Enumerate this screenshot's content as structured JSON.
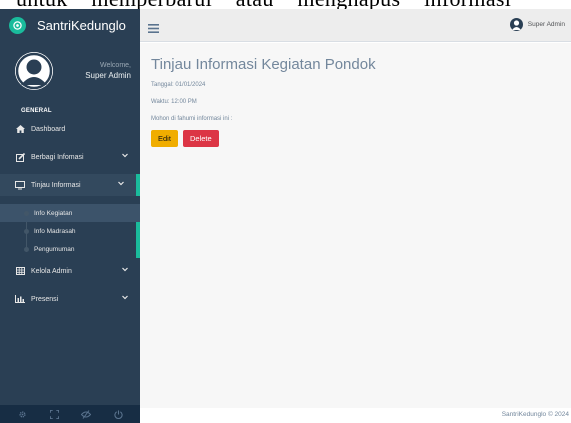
{
  "top_text": "untuk memperbarui atau menghapus informasi",
  "brand": {
    "name": "SantriKedunglo",
    "logo": "logo-icon"
  },
  "profile": {
    "welcome": "Welcome,",
    "name": "Super Admin"
  },
  "sidebar": {
    "section": "GENERAL",
    "items": [
      {
        "label": "Dashboard",
        "icon": "home-icon"
      },
      {
        "label": "Berbagi Infomasi",
        "icon": "edit-icon"
      },
      {
        "label": "Tinjau Informasi",
        "icon": "monitor-icon"
      }
    ],
    "submenu": [
      {
        "label": "Info Kegiatan"
      },
      {
        "label": "Info Madrasah"
      },
      {
        "label": "Pengumuman"
      }
    ],
    "items_after": [
      {
        "label": "Kelola Admin",
        "icon": "table-icon"
      },
      {
        "label": "Presensi",
        "icon": "bar-chart-icon"
      }
    ],
    "footer_icons": [
      "settings-icon",
      "fullscreen-icon",
      "eye-slash-icon",
      "power-icon"
    ]
  },
  "topbar": {
    "user": "Super Admin"
  },
  "main": {
    "title": "Tinjau Informasi Kegiatan Pondok",
    "tanggal": "Tanggal: 01/01/2024",
    "waktu": "Waktu: 12:00 PM",
    "message": "Mohon di fahumi informasi ini :",
    "edit_label": "Edit",
    "delete_label": "Delete"
  },
  "footer": {
    "text": "SantriKedunglo © 2024"
  },
  "colors": {
    "sidebar": "#2a3f54",
    "accent": "#1abb9c",
    "edit": "#f0ad00",
    "delete": "#dc3545"
  }
}
